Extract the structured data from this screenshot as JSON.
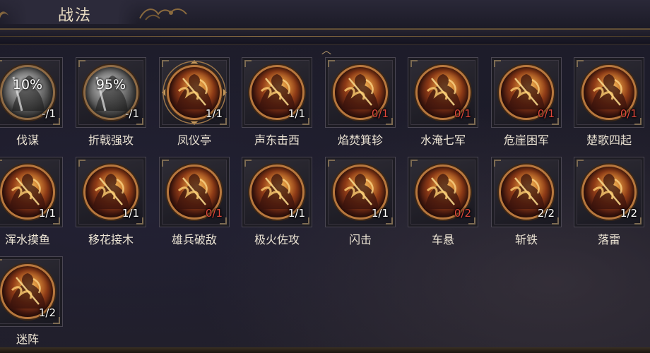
{
  "header": {
    "title": "战法"
  },
  "skills": [
    {
      "name": "伐谋",
      "count": "-/1",
      "count_color": "white",
      "percent": "10%",
      "style": "grey"
    },
    {
      "name": "折戟强攻",
      "count": "-/1",
      "count_color": "white",
      "percent": "95%",
      "style": "grey"
    },
    {
      "name": "凤仪亭",
      "count": "1/1",
      "count_color": "white",
      "percent": "",
      "style": "ornate"
    },
    {
      "name": "声东击西",
      "count": "1/1",
      "count_color": "white",
      "percent": "",
      "style": "fire"
    },
    {
      "name": "焰焚箕轸",
      "count": "0/1",
      "count_color": "red",
      "percent": "",
      "style": "fire"
    },
    {
      "name": "水淹七军",
      "count": "0/1",
      "count_color": "red",
      "percent": "",
      "style": "fire"
    },
    {
      "name": "危崖困军",
      "count": "0/1",
      "count_color": "red",
      "percent": "",
      "style": "fire"
    },
    {
      "name": "楚歌四起",
      "count": "0/1",
      "count_color": "red",
      "percent": "",
      "style": "fire"
    },
    {
      "name": "浑水摸鱼",
      "count": "1/1",
      "count_color": "white",
      "percent": "",
      "style": "fire"
    },
    {
      "name": "移花接木",
      "count": "1/1",
      "count_color": "white",
      "percent": "",
      "style": "fire"
    },
    {
      "name": "雄兵破敌",
      "count": "0/1",
      "count_color": "red",
      "percent": "",
      "style": "fire"
    },
    {
      "name": "极火佐攻",
      "count": "1/1",
      "count_color": "white",
      "percent": "",
      "style": "fire"
    },
    {
      "name": "闪击",
      "count": "1/1",
      "count_color": "white",
      "percent": "",
      "style": "fire"
    },
    {
      "name": "车悬",
      "count": "0/2",
      "count_color": "red",
      "percent": "",
      "style": "fire"
    },
    {
      "name": "斩铁",
      "count": "2/2",
      "count_color": "white",
      "percent": "",
      "style": "fire"
    },
    {
      "name": "落雷",
      "count": "1/2",
      "count_color": "white",
      "percent": "",
      "style": "fire"
    },
    {
      "name": "迷阵",
      "count": "1/2",
      "count_color": "white",
      "percent": "",
      "style": "fire"
    }
  ],
  "colors": {
    "count_red": "#e0483c",
    "text": "#ece4d4",
    "ring_gold": "#b7773d"
  },
  "icons": {
    "scroll_up": "chevron-up-icon",
    "skill_art": "warrior-flame-icon"
  }
}
